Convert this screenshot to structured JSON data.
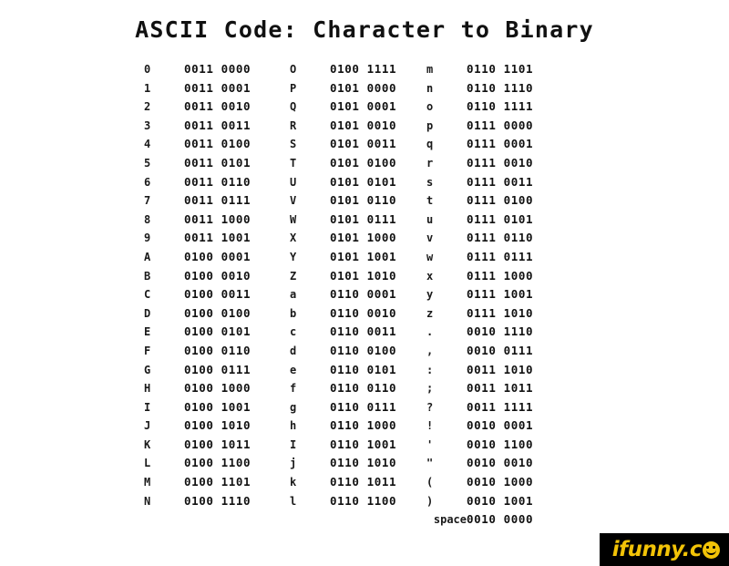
{
  "document": {
    "title": "ASCII Code: Character to Binary",
    "background_color": "#ffffff",
    "text_color": "#111111"
  },
  "table": {
    "columns": [
      {
        "id": "column-1",
        "rows": [
          {
            "char": "0",
            "binary": "0011 0000"
          },
          {
            "char": "1",
            "binary": "0011 0001"
          },
          {
            "char": "2",
            "binary": "0011 0010"
          },
          {
            "char": "3",
            "binary": "0011 0011"
          },
          {
            "char": "4",
            "binary": "0011 0100"
          },
          {
            "char": "5",
            "binary": "0011 0101"
          },
          {
            "char": "6",
            "binary": "0011 0110"
          },
          {
            "char": "7",
            "binary": "0011 0111"
          },
          {
            "char": "8",
            "binary": "0011 1000"
          },
          {
            "char": "9",
            "binary": "0011 1001"
          },
          {
            "char": "A",
            "binary": "0100 0001"
          },
          {
            "char": "B",
            "binary": "0100 0010"
          },
          {
            "char": "C",
            "binary": "0100 0011"
          },
          {
            "char": "D",
            "binary": "0100 0100"
          },
          {
            "char": "E",
            "binary": "0100 0101"
          },
          {
            "char": "F",
            "binary": "0100 0110"
          },
          {
            "char": "G",
            "binary": "0100 0111"
          },
          {
            "char": "H",
            "binary": "0100 1000"
          },
          {
            "char": "I",
            "binary": "0100 1001"
          },
          {
            "char": "J",
            "binary": "0100 1010"
          },
          {
            "char": "K",
            "binary": "0100 1011"
          },
          {
            "char": "L",
            "binary": "0100 1100"
          },
          {
            "char": "M",
            "binary": "0100 1101"
          },
          {
            "char": "N",
            "binary": "0100 1110"
          }
        ]
      },
      {
        "id": "column-2",
        "rows": [
          {
            "char": "O",
            "binary": "0100 1111"
          },
          {
            "char": "P",
            "binary": "0101 0000"
          },
          {
            "char": "Q",
            "binary": "0101 0001"
          },
          {
            "char": "R",
            "binary": "0101 0010"
          },
          {
            "char": "S",
            "binary": "0101 0011"
          },
          {
            "char": "T",
            "binary": "0101 0100"
          },
          {
            "char": "U",
            "binary": "0101 0101"
          },
          {
            "char": "V",
            "binary": "0101 0110"
          },
          {
            "char": "W",
            "binary": "0101 0111"
          },
          {
            "char": "X",
            "binary": "0101 1000"
          },
          {
            "char": "Y",
            "binary": "0101 1001"
          },
          {
            "char": "Z",
            "binary": "0101 1010"
          },
          {
            "char": "a",
            "binary": "0110 0001"
          },
          {
            "char": "b",
            "binary": "0110 0010"
          },
          {
            "char": "c",
            "binary": "0110 0011"
          },
          {
            "char": "d",
            "binary": "0110 0100"
          },
          {
            "char": "e",
            "binary": "0110 0101"
          },
          {
            "char": "f",
            "binary": "0110 0110"
          },
          {
            "char": "g",
            "binary": "0110 0111"
          },
          {
            "char": "h",
            "binary": "0110 1000"
          },
          {
            "char": "I",
            "binary": "0110 1001"
          },
          {
            "char": "j",
            "binary": "0110 1010"
          },
          {
            "char": "k",
            "binary": "0110 1011"
          },
          {
            "char": "l",
            "binary": "0110 1100"
          }
        ]
      },
      {
        "id": "column-3",
        "rows": [
          {
            "char": "m",
            "binary": "0110 1101"
          },
          {
            "char": "n",
            "binary": "0110 1110"
          },
          {
            "char": "o",
            "binary": "0110 1111"
          },
          {
            "char": "p",
            "binary": "0111 0000"
          },
          {
            "char": "q",
            "binary": "0111 0001"
          },
          {
            "char": "r",
            "binary": "0111 0010"
          },
          {
            "char": "s",
            "binary": "0111 0011"
          },
          {
            "char": "t",
            "binary": "0111 0100"
          },
          {
            "char": "u",
            "binary": "0111 0101"
          },
          {
            "char": "v",
            "binary": "0111 0110"
          },
          {
            "char": "w",
            "binary": "0111 0111"
          },
          {
            "char": "x",
            "binary": "0111 1000"
          },
          {
            "char": "y",
            "binary": "0111 1001"
          },
          {
            "char": "z",
            "binary": "0111 1010"
          },
          {
            "char": ".",
            "binary": "0010 1110"
          },
          {
            "char": ",",
            "binary": "0010 0111"
          },
          {
            "char": ":",
            "binary": "0011 1010"
          },
          {
            "char": ";",
            "binary": "0011 1011"
          },
          {
            "char": "?",
            "binary": "0011 1111"
          },
          {
            "char": "!",
            "binary": "0010 0001"
          },
          {
            "char": "'",
            "binary": "0010 1100"
          },
          {
            "char": "\"",
            "binary": "0010 0010"
          },
          {
            "char": "(",
            "binary": "0010 1000"
          },
          {
            "char": ")",
            "binary": "0010 1001"
          },
          {
            "char": "space",
            "binary": "0010 0000",
            "wide": true
          }
        ]
      }
    ]
  },
  "watermark": {
    "text": "ifunny.c",
    "icon": "smiley-face-icon",
    "background_color": "#000000",
    "text_color": "#f2c307"
  }
}
